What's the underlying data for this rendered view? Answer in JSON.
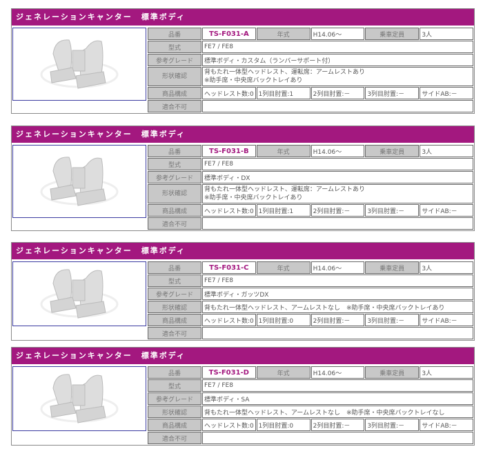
{
  "labels": {
    "code": "品番",
    "year": "年式",
    "capacity": "乗車定員",
    "model": "型式",
    "grade": "参考グレード",
    "shape": "形状確認",
    "components": "商品構成",
    "incompatible": "適合不可"
  },
  "products": [
    {
      "title": "ジェネレーションキャンター　標準ボディ",
      "code": "TS-F031-A",
      "year": "H14.06～",
      "capacity": "3人",
      "model": "FE7 / FE8",
      "grade": "標準ボディ・カスタム（ランバーサポート付）",
      "shape_line1": "背もたれ一体型ヘッドレスト、運転席：アームレストあり",
      "shape_line2": "※助手席・中央席バックトレイあり",
      "headrest": "ヘッドレスト数:0",
      "row1": "1列目肘置:1",
      "row2": "2列目肘置:－",
      "row3": "3列目肘置:－",
      "side": "サイドAB:－",
      "incompatible": ""
    },
    {
      "title": "ジェネレーションキャンター　標準ボディ",
      "code": "TS-F031-B",
      "year": "H14.06～",
      "capacity": "3人",
      "model": "FE7 / FE8",
      "grade": "標準ボディ・DX",
      "shape_line1": "背もたれ一体型ヘッドレスト、運転席：アームレストあり",
      "shape_line2": "※助手席・中央席バックトレイあり",
      "headrest": "ヘッドレスト数:0",
      "row1": "1列目肘置:1",
      "row2": "2列目肘置:－",
      "row3": "3列目肘置:－",
      "side": "サイドAB:－",
      "incompatible": ""
    },
    {
      "title": "ジェネレーションキャンター　標準ボディ",
      "code": "TS-F031-C",
      "year": "H14.06～",
      "capacity": "3人",
      "model": "FE7 / FE8",
      "grade": "標準ボディ・ガッツDX",
      "shape_line1": "背もたれ一体型ヘッドレスト、アームレストなし　※助手席・中央席バックトレイあり",
      "headrest": "ヘッドレスト数:0",
      "row1": "1列目肘置:0",
      "row2": "2列目肘置:－",
      "row3": "3列目肘置:－",
      "side": "サイドAB:－",
      "incompatible": ""
    },
    {
      "title": "ジェネレーションキャンター　標準ボディ",
      "code": "TS-F031-D",
      "year": "H14.06～",
      "capacity": "3人",
      "model": "FE7 / FE8",
      "grade": "標準ボディ・SA",
      "shape_line1": "背もたれ一体型ヘッドレスト、アームレストなし　※助手席・中央席バックトレイなし",
      "headrest": "ヘッドレスト数:0",
      "row1": "1列目肘置:0",
      "row2": "2列目肘置:－",
      "row3": "3列目肘置:－",
      "side": "サイドAB:－",
      "incompatible": ""
    }
  ]
}
